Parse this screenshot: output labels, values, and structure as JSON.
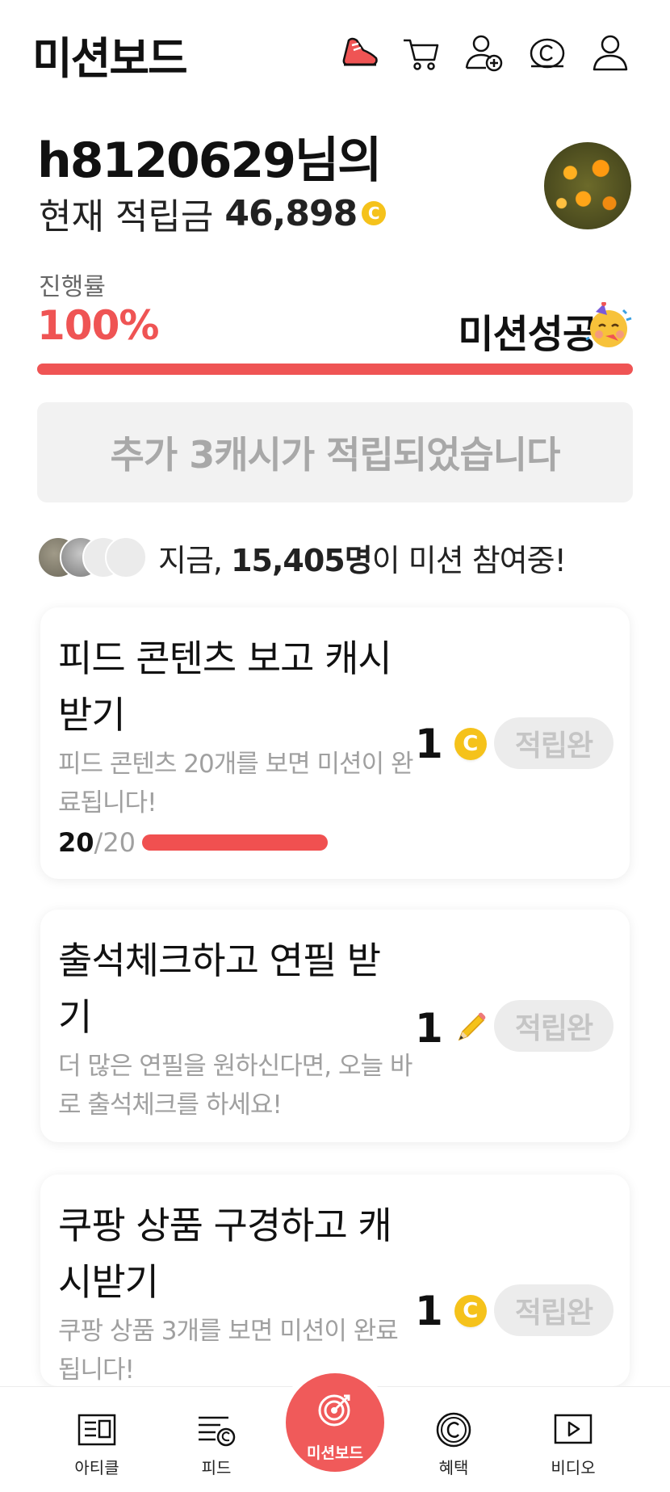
{
  "header": {
    "title": "미션보드",
    "icons": [
      "shoe-icon",
      "cart-icon",
      "add-user-icon",
      "cash-icon",
      "profile-icon"
    ]
  },
  "user": {
    "name_line": "h8120629님의",
    "balance_label": "현재 적립금",
    "balance_amount": "46,898",
    "coin_symbol": "C"
  },
  "progress": {
    "label": "진행률",
    "value_text": "100%",
    "fraction": 1.0,
    "status": "미션성공"
  },
  "banner": {
    "text": "추가 3캐시가 적립되었습니다"
  },
  "participants": {
    "prefix": "지금,",
    "count": "15,405명",
    "suffix": "이 미션 참여중!"
  },
  "missions": [
    {
      "title": "피드 콘텐츠 보고 캐시 받기",
      "desc": "피드 콘텐츠 20개를 보면 미션이 완료됩니다!",
      "reward": "1",
      "reward_icon": "coin-icon",
      "button": "적립완",
      "progress_current": "20",
      "progress_total": "/20",
      "progress_fraction": 1.0
    },
    {
      "title": "출석체크하고 연필 받기",
      "desc": "더 많은 연필을 원하신다면, 오늘 바로 출석체크를 하세요!",
      "reward": "1",
      "reward_icon": "pencil-icon",
      "button": "적립완"
    },
    {
      "title": "쿠팡 상품 구경하고 캐시받기",
      "desc": "쿠팡 상품 3개를 보면 미션이 완료됩니다!",
      "reward": "1",
      "reward_icon": "coin-icon",
      "button": "적립완"
    }
  ],
  "nav": {
    "items": [
      {
        "label": "아티클",
        "icon": "article-icon"
      },
      {
        "label": "피드",
        "icon": "feed-icon"
      },
      {
        "label": "미션보드",
        "icon": "target-icon"
      },
      {
        "label": "혜택",
        "icon": "benefit-icon"
      },
      {
        "label": "비디오",
        "icon": "video-icon"
      }
    ]
  },
  "colors": {
    "accent": "#ef5454",
    "coin": "#f5c21b",
    "muted_text": "#a0a0a0",
    "banner_bg": "#f2f2f2"
  }
}
